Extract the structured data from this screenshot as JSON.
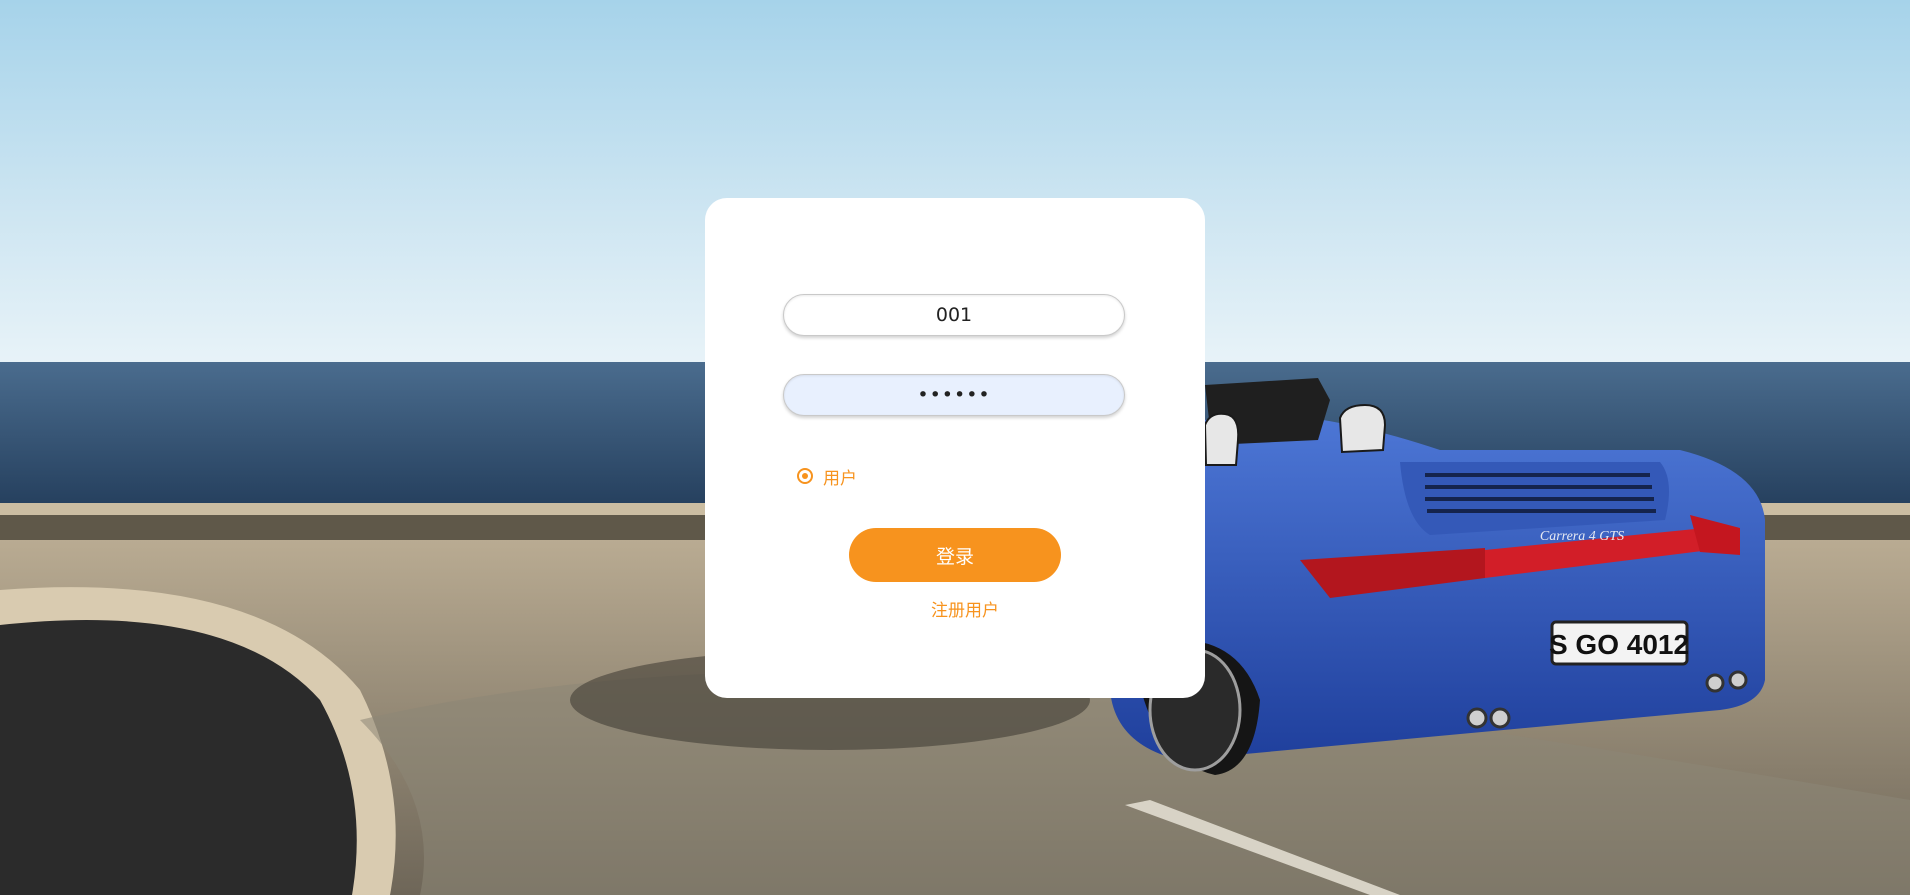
{
  "login": {
    "username_value": "001",
    "password_value": "••••••",
    "role_label": "用户",
    "login_button_label": "登录",
    "register_link_label": "注册用户"
  },
  "background": {
    "license_plate": "S GO 4012",
    "car_badge": "Carrera 4 GTS"
  },
  "colors": {
    "accent": "#f7931e",
    "card": "#ffffff",
    "password_field": "#e8f0fe"
  }
}
